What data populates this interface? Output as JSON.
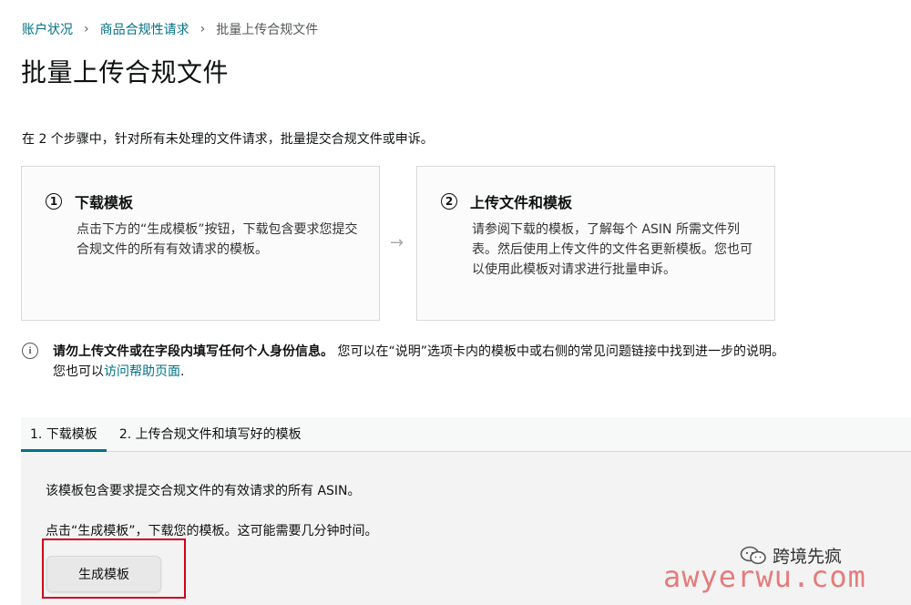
{
  "breadcrumb": {
    "items": [
      "账户状况",
      "商品合规性请求"
    ],
    "current": "批量上传合规文件",
    "separator": "›"
  },
  "page": {
    "title": "批量上传合规文件",
    "intro": "在 2 个步骤中，针对所有未处理的文件请求，批量提交合规文件或申诉。"
  },
  "steps": [
    {
      "number": "1",
      "title": "下载模板",
      "body": "点击下方的“生成模板”按钮，下载包含要求您提交合规文件的所有有效请求的模板。"
    },
    {
      "number": "2",
      "title": "上传文件和模板",
      "body": "请参阅下载的模板，了解每个 ASIN 所需文件列表。然后使用上传文件的文件名更新模板。您也可以使用此模板对请求进行批量申诉。"
    }
  ],
  "step_arrow": "→",
  "notice": {
    "icon": "info-icon",
    "bold": "请勿上传文件或在字段内填写任何个人身份信息。",
    "text": "您可以在“说明”选项卡内的模板中或右侧的常见问题链接中找到进一步的说明。",
    "line2_prefix": "您也可以",
    "link": "访问帮助页面",
    "line2_suffix": "."
  },
  "tabs": [
    {
      "label": "1. 下载模板",
      "active": true
    },
    {
      "label": "2. 上传合规文件和填写好的模板",
      "active": false
    }
  ],
  "panel": {
    "line1": "该模板包含要求提交合规文件的有效请求的所有 ASIN。",
    "line2": "点击“生成模板”，下载您的模板。这可能需要几分钟时间。",
    "button": "生成模板"
  },
  "watermark": {
    "name": "跨境先疯",
    "url": "awyerwu.com"
  },
  "colors": {
    "link": "#007185",
    "tab_underline": "#007185",
    "highlight": "#d0021b"
  }
}
